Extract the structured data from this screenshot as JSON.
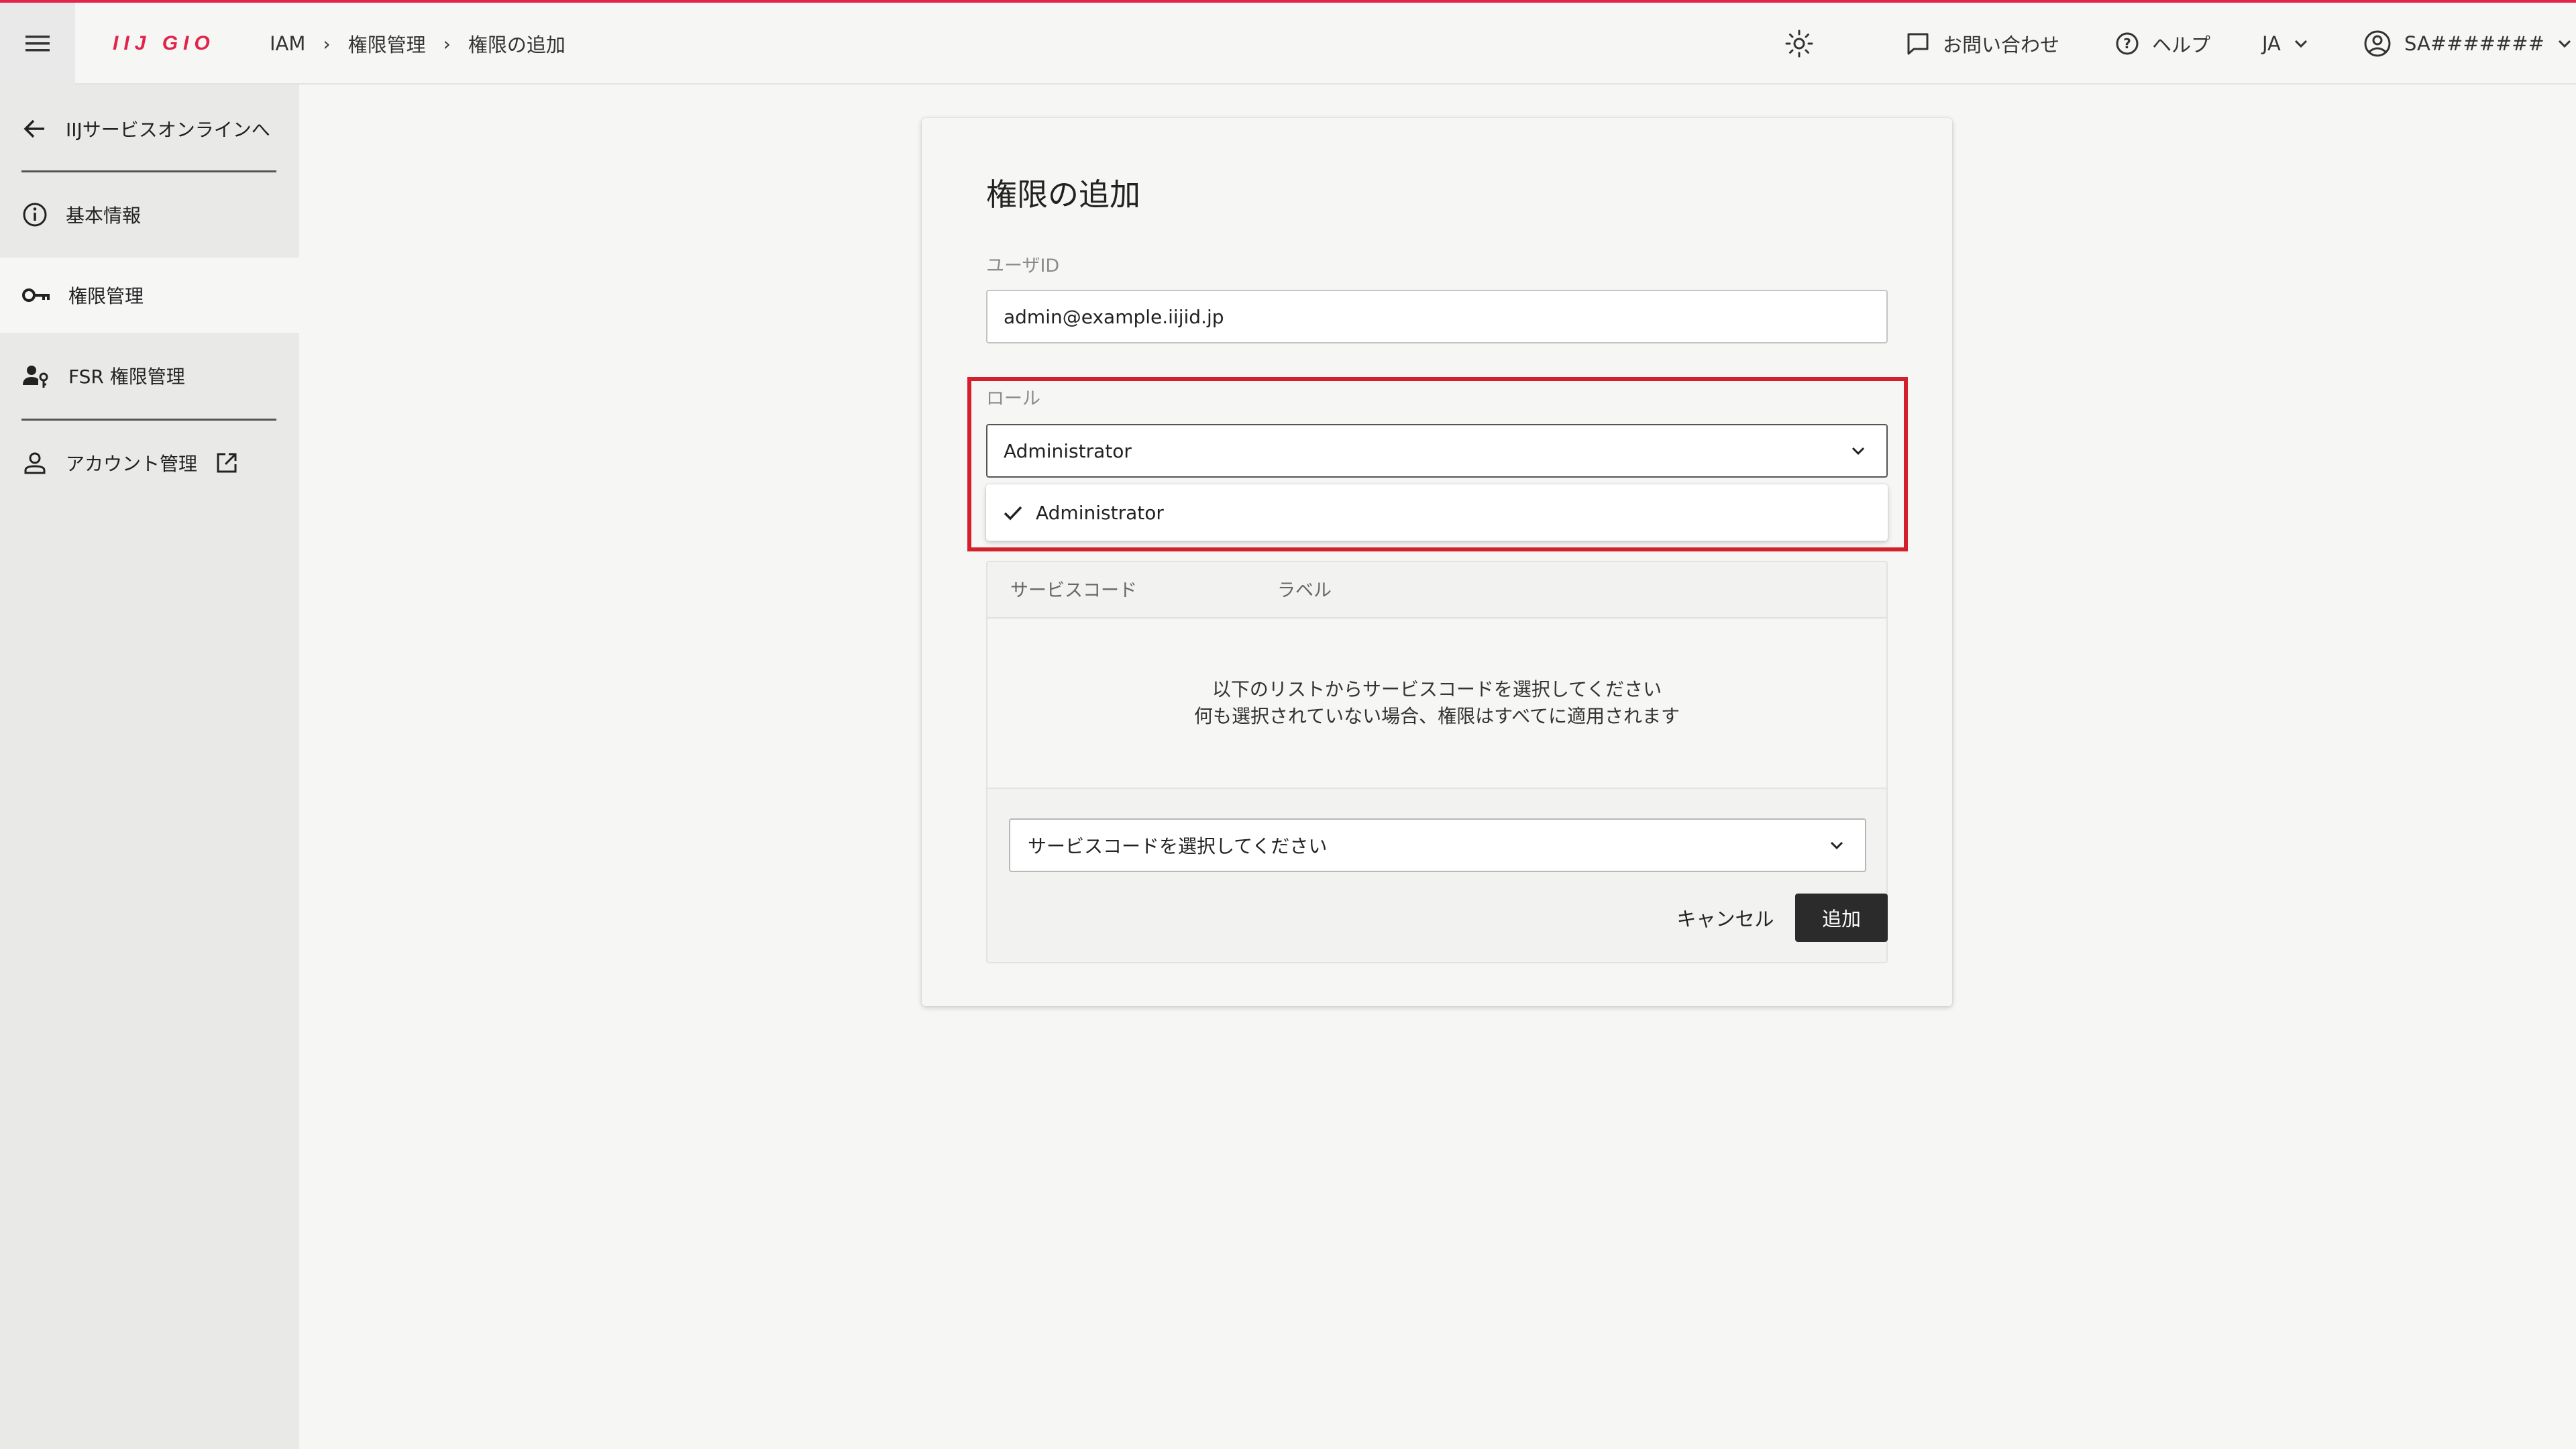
{
  "colors": {
    "brand": "#e0244a",
    "highlight": "#d4202a",
    "primary_button": "#2b2b2b"
  },
  "header": {
    "logo_text": "IIJ GIO",
    "breadcrumb": [
      "IAM",
      "権限管理",
      "権限の追加"
    ],
    "breadcrumb_separator": "›",
    "theme_icon": "sun-icon",
    "contact_label": "お問い合わせ",
    "help_label": "ヘルプ",
    "language": "JA",
    "account": "SA#######"
  },
  "sidebar": {
    "back_label": "IIJサービスオンラインへ",
    "items": [
      {
        "label": "基本情報",
        "icon": "info-icon"
      },
      {
        "label": "権限管理",
        "icon": "key-icon",
        "active": true
      },
      {
        "label": "FSR 権限管理",
        "icon": "user-key-icon"
      },
      {
        "label": "アカウント管理",
        "icon": "person-icon",
        "external": true
      }
    ]
  },
  "form": {
    "title": "権限の追加",
    "user_id_label": "ユーザID",
    "user_id_value": "admin@example.iijid.jp",
    "role_label": "ロール",
    "role_value": "Administrator",
    "role_options": [
      {
        "label": "Administrator",
        "selected": true
      }
    ],
    "service_table": {
      "col_service_code": "サービスコード",
      "col_label": "ラベル",
      "empty_line1": "以下のリストからサービスコードを選択してください",
      "empty_line2": "何も選択されていない場合、権限はすべてに適用されます",
      "select_placeholder": "サービスコードを選択してください"
    },
    "cancel_label": "キャンセル",
    "submit_label": "追加"
  }
}
